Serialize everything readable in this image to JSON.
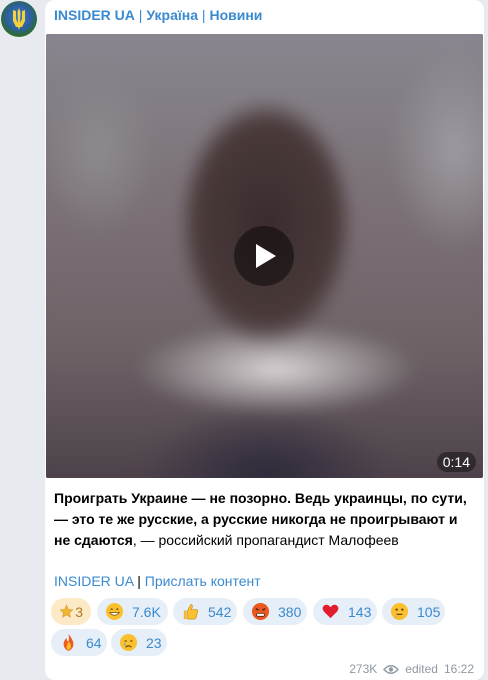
{
  "channel": {
    "name": "INSIDER UA",
    "sep": " | ",
    "part2": "Україна",
    "sep2": " | ",
    "part3": "Новини"
  },
  "video": {
    "duration": "0:14"
  },
  "caption": {
    "bold": "Проиграть Украине — не позорно. Ведь украинцы, по сути, — это те же русские, а русские никогда не проигрывают и не сдаются",
    "rest": ", — российский пропагандист Малофеев"
  },
  "links": {
    "channel": "INSIDER UA",
    "sep": " | ",
    "submit": "Прислать контент"
  },
  "reactions": [
    {
      "icon": "star-icon",
      "count": "3"
    },
    {
      "icon": "grin-emoji-icon",
      "count": "7.6K"
    },
    {
      "icon": "thumbs-up-emoji-icon",
      "count": "542"
    },
    {
      "icon": "angry-emoji-icon",
      "count": "380"
    },
    {
      "icon": "heart-emoji-icon",
      "count": "143"
    },
    {
      "icon": "thinking-emoji-icon",
      "count": "105"
    },
    {
      "icon": "fire-emoji-icon",
      "count": "64"
    },
    {
      "icon": "crying-emoji-icon",
      "count": "23"
    }
  ],
  "meta": {
    "views": "273K",
    "edited": "edited",
    "time": "16:22"
  },
  "colors": {
    "link": "#3a8ad0",
    "reaction_bg": "#e6eef7",
    "star_bg": "#fce9c6"
  }
}
